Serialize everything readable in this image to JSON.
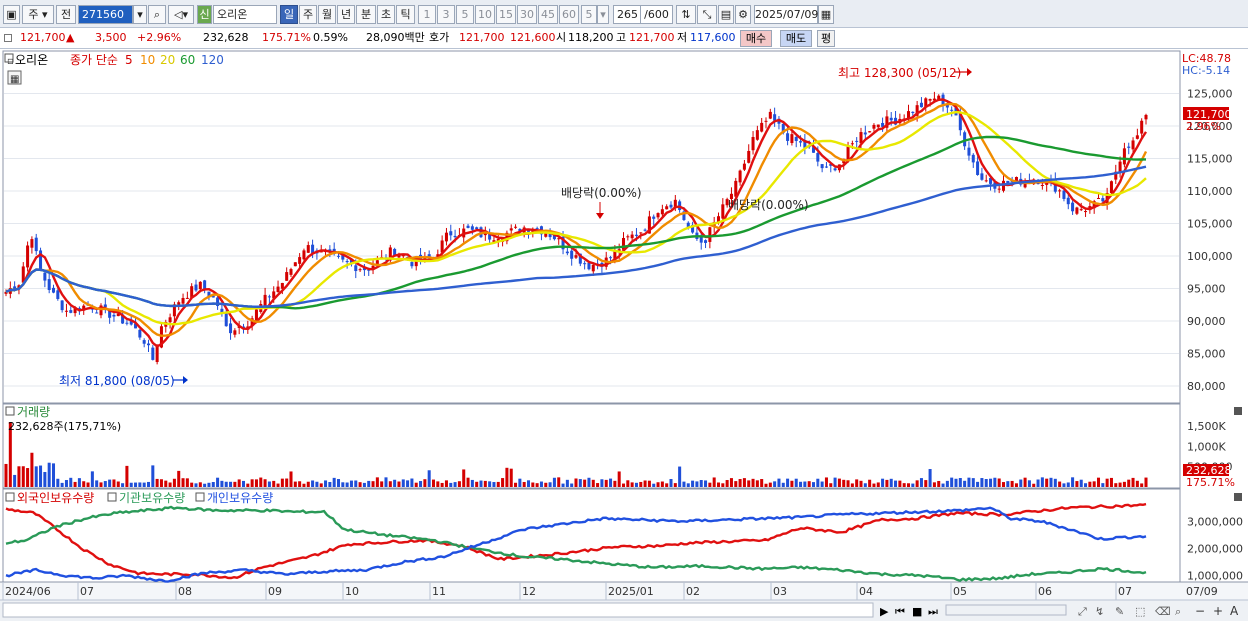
{
  "toolbar": {
    "period_labels": [
      "주",
      "전"
    ],
    "stock_code": "271560",
    "new_badge": "신",
    "stock_name": "오리온",
    "intervals": [
      "일",
      "주",
      "월",
      "년",
      "분",
      "초",
      "틱"
    ],
    "minute_steps": [
      "1",
      "3",
      "5",
      "10",
      "15",
      "30",
      "45",
      "60"
    ],
    "step_value": "5",
    "count_value": "265",
    "count_total": "/600",
    "date_value": "2025/07/09"
  },
  "info": {
    "price": "121,700",
    "up_arrow": "▲",
    "change": "3,500",
    "change_pct": "+2.96%",
    "volume": "232,628",
    "volume_ratio": "175.71%",
    "turnover_pct": "0.59%",
    "amount": "28,090백만",
    "quote_label": "호가",
    "ask": "121,700",
    "bid": "121,600",
    "open_label": "시",
    "open": "118,200",
    "high_label": "고",
    "high": "121,700",
    "low_label": "저",
    "low": "117,600",
    "buy_label": "매수",
    "sell_label": "매도",
    "eval_label": "평"
  },
  "chart_data": [
    {
      "type": "candlestick",
      "legend": {
        "name": "오리온",
        "close_label": "종가 단순",
        "ma_periods": [
          "5",
          "10",
          "20",
          "60",
          "120"
        ],
        "ma_colors": [
          "#e01010",
          "#f08c00",
          "#e8e800",
          "#1a9a30",
          "#2f5fd0"
        ]
      },
      "lc": "LC:48.78",
      "hc": "HC:-5.14",
      "current_price_label": "121,700",
      "current_pct_label": "2.96%",
      "ylim": [
        78000,
        130000
      ],
      "yticks": [
        80000,
        85000,
        90000,
        95000,
        100000,
        105000,
        110000,
        115000,
        120000,
        125000
      ],
      "ytick_labels": [
        "80,000",
        "85,000",
        "90,000",
        "95,000",
        "100,000",
        "105,000",
        "110,000",
        "115,000",
        "120,000",
        "125,000"
      ],
      "annotations": {
        "high": "최고 128,300 (05/12)",
        "low": "최저 81,800 (08/05)",
        "dividend1": "배당락(0.00%)",
        "dividend2": "배당락(0.00%)"
      },
      "anchors": [
        [
          0,
          94500
        ],
        [
          5,
          96000
        ],
        [
          9,
          104000
        ],
        [
          12,
          98000
        ],
        [
          17,
          94000
        ],
        [
          22,
          91500
        ],
        [
          30,
          92500
        ],
        [
          38,
          91000
        ],
        [
          45,
          89500
        ],
        [
          50,
          87000
        ],
        [
          53,
          84000
        ],
        [
          56,
          89000
        ],
        [
          63,
          93500
        ],
        [
          70,
          95500
        ],
        [
          76,
          93000
        ],
        [
          80,
          88500
        ],
        [
          88,
          90000
        ],
        [
          94,
          93500
        ],
        [
          100,
          96000
        ],
        [
          108,
          101500
        ],
        [
          114,
          100500
        ],
        [
          122,
          99000
        ],
        [
          130,
          98000
        ],
        [
          136,
          99500
        ],
        [
          140,
          101000
        ],
        [
          147,
          99000
        ],
        [
          154,
          99500
        ],
        [
          160,
          103500
        ],
        [
          167,
          104000
        ],
        [
          174,
          103000
        ],
        [
          181,
          103500
        ],
        [
          188,
          104500
        ],
        [
          194,
          104000
        ],
        [
          198,
          103000
        ],
        [
          204,
          100500
        ],
        [
          211,
          98500
        ],
        [
          218,
          99500
        ],
        [
          224,
          102500
        ],
        [
          230,
          104000
        ],
        [
          236,
          107500
        ],
        [
          242,
          108500
        ],
        [
          248,
          103000
        ],
        [
          252,
          102000
        ],
        [
          258,
          106500
        ],
        [
          264,
          111000
        ],
        [
          270,
          118000
        ],
        [
          276,
          121500
        ],
        [
          282,
          118500
        ],
        [
          290,
          116500
        ],
        [
          296,
          113000
        ],
        [
          302,
          114500
        ],
        [
          308,
          118500
        ],
        [
          315,
          120500
        ],
        [
          322,
          121000
        ],
        [
          330,
          123000
        ],
        [
          336,
          124500
        ],
        [
          342,
          122500
        ],
        [
          346,
          118000
        ],
        [
          352,
          112000
        ],
        [
          358,
          111000
        ],
        [
          365,
          111500
        ],
        [
          372,
          112000
        ],
        [
          380,
          110500
        ],
        [
          386,
          107000
        ],
        [
          392,
          107500
        ],
        [
          398,
          109000
        ],
        [
          404,
          117000
        ],
        [
          408,
          117500
        ],
        [
          412,
          121700
        ]
      ],
      "volume_panel": {
        "title": "거래량",
        "label": "232,628주(175,71%)",
        "yticks": [
          500000,
          1000000,
          1500000
        ],
        "ytick_labels": [
          "500,000",
          "1,000K",
          "1,500K"
        ],
        "ylim": [
          0,
          1800000
        ],
        "last_value_label": "232,628",
        "last_pct_label": "175.71%"
      },
      "holding_panel": {
        "series": [
          {
            "name": "외국인보유수량",
            "color": "#e01010",
            "anchors": [
              [
                0,
                3450000
              ],
              [
                15,
                3300000
              ],
              [
                25,
                2800000
              ],
              [
                40,
                2000000
              ],
              [
                55,
                1400000
              ],
              [
                70,
                1080000
              ],
              [
                85,
                1050000
              ],
              [
                100,
                1050000
              ],
              [
                120,
                920000
              ],
              [
                135,
                1300000
              ],
              [
                160,
                1700000
              ],
              [
                180,
                2150000
              ],
              [
                205,
                2250000
              ],
              [
                220,
                2300000
              ],
              [
                240,
                2100000
              ],
              [
                260,
                1600000
              ],
              [
                290,
                1800000
              ],
              [
                320,
                2050000
              ],
              [
                345,
                2100000
              ],
              [
                360,
                2200000
              ],
              [
                378,
                2250000
              ],
              [
                400,
                2300000
              ],
              [
                418,
                2750000
              ],
              [
                440,
                2600000
              ],
              [
                460,
                3050000
              ],
              [
                478,
                3100000
              ],
              [
                500,
                3300000
              ],
              [
                525,
                3250000
              ],
              [
                560,
                3500000
              ],
              [
                600,
                3600000
              ]
            ]
          },
          {
            "name": "기관보유수량",
            "color": "#2a9a58",
            "anchors": [
              [
                0,
                2200000
              ],
              [
                20,
                2300000
              ],
              [
                50,
                2800000
              ],
              [
                80,
                3100000
              ],
              [
                110,
                3300000
              ],
              [
                140,
                3400000
              ],
              [
                170,
                3500000
              ],
              [
                210,
                3400000
              ],
              [
                260,
                3400000
              ],
              [
                290,
                3350000
              ],
              [
                320,
                3350000
              ],
              [
                340,
                2700000
              ],
              [
                380,
                2500000
              ],
              [
                430,
                2300000
              ],
              [
                470,
                2000000
              ],
              [
                520,
                1700000
              ],
              [
                560,
                1600000
              ],
              [
                600,
                1450000
              ],
              [
                650,
                1300000
              ],
              [
                700,
                1350000
              ],
              [
                760,
                1250000
              ],
              [
                800,
                1300000
              ],
              [
                840,
                1200000
              ],
              [
                880,
                1050000
              ],
              [
                920,
                1000000
              ],
              [
                960,
                850000
              ],
              [
                1000,
                900000
              ],
              [
                1030,
                1050000
              ],
              [
                1060,
                1100000
              ],
              [
                1100,
                1250000
              ],
              [
                1120,
                1200000
              ],
              [
                1146,
                1100000
              ]
            ]
          },
          {
            "name": "개인보유수량",
            "color": "#2050e0",
            "anchors": [
              [
                0,
                1000000
              ],
              [
                30,
                1200000
              ],
              [
                60,
                1000000
              ],
              [
                90,
                900000
              ],
              [
                120,
                1000000
              ],
              [
                160,
                800000
              ],
              [
                200,
                1100000
              ],
              [
                240,
                1200000
              ],
              [
                280,
                1050000
              ],
              [
                320,
                1150000
              ],
              [
                360,
                1200000
              ],
              [
                400,
                1500000
              ],
              [
                440,
                1700000
              ],
              [
                480,
                2200000
              ],
              [
                520,
                2700000
              ],
              [
                560,
                2900000
              ],
              [
                600,
                3100000
              ],
              [
                640,
                3050000
              ],
              [
                680,
                3000000
              ],
              [
                720,
                3050000
              ],
              [
                760,
                3100000
              ],
              [
                800,
                3150000
              ],
              [
                840,
                3250000
              ],
              [
                880,
                3300000
              ],
              [
                920,
                3350000
              ],
              [
                960,
                3400000
              ],
              [
                990,
                3500000
              ],
              [
                1010,
                3100000
              ],
              [
                1040,
                3000000
              ],
              [
                1070,
                2700000
              ],
              [
                1100,
                2350000
              ],
              [
                1120,
                2400000
              ],
              [
                1146,
                2450000
              ]
            ]
          }
        ],
        "ylim": [
          800000,
          3600000
        ],
        "yticks": [
          1000000,
          2000000,
          3000000
        ],
        "ytick_labels": [
          "1,000,000",
          "2,000,000",
          "3,000,000"
        ]
      },
      "x_labels": [
        "2024/06",
        "07",
        "08",
        "09",
        "10",
        "11",
        "12",
        "2025/01",
        "02",
        "03",
        "04",
        "05",
        "06",
        "07",
        "07/09"
      ]
    }
  ]
}
